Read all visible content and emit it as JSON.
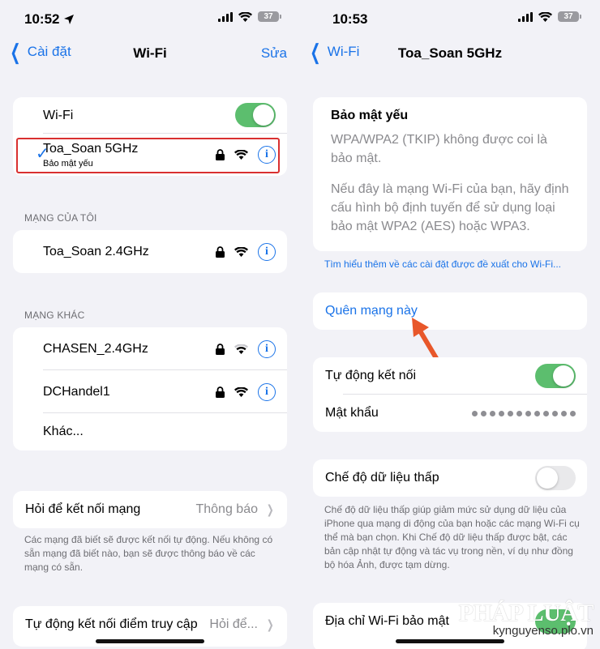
{
  "left": {
    "status": {
      "time": "10:52",
      "battery": "37"
    },
    "nav": {
      "back": "Cài đặt",
      "title": "Wi-Fi",
      "edit": "Sửa"
    },
    "wifi_card": {
      "wifi_label": "Wi-Fi",
      "wifi_on": true,
      "current_network": "Toa_Soan 5GHz",
      "current_subtitle": "Bảo mật yếu"
    },
    "my_networks": {
      "header": "MẠNG CỦA TÔI",
      "items": [
        {
          "name": "Toa_Soan 2.4GHz"
        }
      ]
    },
    "other_networks": {
      "header": "MẠNG KHÁC",
      "items": [
        {
          "name": "CHASEN_2.4GHz"
        },
        {
          "name": "DCHandel1"
        }
      ],
      "other_label": "Khác..."
    },
    "ask_join": {
      "label": "Hỏi để kết nối mạng",
      "value": "Thông báo",
      "footnote": "Các mạng đã biết sẽ được kết nối tự động. Nếu không có sẵn mạng đã biết nào, bạn sẽ được thông báo về các mạng có sẵn."
    },
    "auto_hotspot": {
      "label": "Tự động kết nối điểm truy cập",
      "value": "Hỏi để..."
    }
  },
  "right": {
    "status": {
      "time": "10:53",
      "battery": "37"
    },
    "nav": {
      "back": "Wi-Fi",
      "title": "Toa_Soan 5GHz"
    },
    "warning": {
      "title": "Bảo mật yếu",
      "p1": "WPA/WPA2 (TKIP) không được coi là bảo mật.",
      "p2": "Nếu đây là mạng Wi-Fi của bạn, hãy định cấu hình bộ định tuyến để sử dụng loại bảo mật WPA2 (AES) hoặc WPA3.",
      "link": "Tìm hiểu thêm về các cài đặt được đề xuất cho Wi-Fi..."
    },
    "forget": {
      "label": "Quên mạng này"
    },
    "auto_join": {
      "label": "Tự động kết nối",
      "on": true
    },
    "password": {
      "label": "Mật khẩu",
      "masked": "••••••••••••"
    },
    "low_data": {
      "label": "Chế độ dữ liệu thấp",
      "on": false,
      "footnote": "Chế độ dữ liệu thấp giúp giảm mức sử dụng dữ liệu của iPhone qua mạng di động của bạn hoặc các mạng Wi-Fi cụ thể mà bạn chọn. Khi Chế độ dữ liệu thấp được bật, các bản cập nhật tự động và tác vụ trong nền, ví dụ như đồng bộ hóa Ảnh, được tạm dừng."
    },
    "private_addr": {
      "label": "Địa chỉ Wi-Fi bảo mật"
    }
  },
  "watermark": {
    "logo": "PHÁP LUẬT",
    "site": "kynguyenso.plo.vn"
  },
  "colors": {
    "accent": "#1a73e8",
    "toggle_on": "#5cbe6e",
    "highlight": "#d93030",
    "arrow": "#e8572a"
  }
}
